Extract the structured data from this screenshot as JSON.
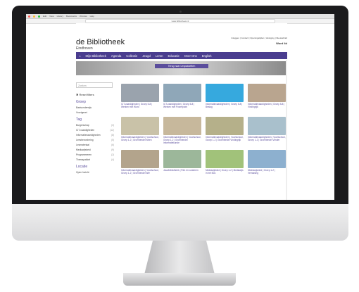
{
  "browser": {
    "menu": [
      "Edit",
      "View",
      "History",
      "Bookmarks",
      "Window",
      "Help"
    ],
    "url": "www.bibliotheek.nl"
  },
  "site": {
    "top_links": "Inloggen | Contact | Openingstijden | Vestiging | Nieuwsbrief",
    "logo": "de Bibliotheek",
    "logo_sub": "Eindhoven",
    "account_link": "Word lid",
    "nav": [
      "Mijn Bibliotheek",
      "Agenda",
      "Collectie",
      "Jeugd",
      "Leren",
      "Educatie",
      "Over Ons",
      "English"
    ],
    "hero_button": "Terug naar Lespakketten"
  },
  "sidebar": {
    "search_placeholder": "Zoeken",
    "reset": "Reset filters",
    "groups": [
      {
        "title": "Groep",
        "items": [
          {
            "label": "Basisonderwijs",
            "count": ""
          },
          {
            "label": "Voortgezet",
            "count": ""
          }
        ]
      },
      {
        "title": "Tag",
        "items": [
          {
            "label": "Burgerschap",
            "count": "(3)"
          },
          {
            "label": "ICT-vaardigheden",
            "count": "(12)"
          },
          {
            "label": "Informatievaardigheden",
            "count": "(8)"
          },
          {
            "label": "Leesbevordering",
            "count": "(5)"
          },
          {
            "label": "Lesmateriaal",
            "count": "(6)"
          },
          {
            "label": "Mediawijsheid",
            "count": "(9)"
          },
          {
            "label": "Programmeren",
            "count": "(2)"
          },
          {
            "label": "Themapakket",
            "count": "(4)"
          }
        ]
      },
      {
        "title": "Locatie",
        "items": [
          {
            "label": "Open Inzicht",
            "count": ""
          }
        ]
      }
    ]
  },
  "cards": [
    {
      "title": "ICT-vaardigheden | Groep 5-8 | Werken met Word",
      "color": "#9aa3ad"
    },
    {
      "title": "ICT-vaardigheden | Groep 5-8 | Werken met Powerpoint",
      "color": "#8fa7b8"
    },
    {
      "title": "Informatievaardigheden | Groep 5-8 | Beslag",
      "color": "#36a9de"
    },
    {
      "title": "Informatievaardigheden | Groep 5-8 | Vindingrijk",
      "color": "#b9a58f"
    },
    {
      "title": "Informatievaardigheden | Voortschool, Groep 1-2 | Groentendel Kitten",
      "color": "#c9c2a8"
    },
    {
      "title": "Informatievaardigheden | Voortschool, Groep 1-2 | Groentendel Informatiekunde",
      "color": "#c7b89c"
    },
    {
      "title": "Informatievaardigheden | Voortschool, Groep 1-2 | Groentendel Vindingrijk",
      "color": "#b5b08a"
    },
    {
      "title": "Informatievaardigheden | Voortschool, Groep 1-2 | Groentendel Vlinder",
      "color": "#a9c0cc"
    },
    {
      "title": "Informatievaardigheden | Voortschool, Groep 1-2 | Groentendel Wie",
      "color": "#b3a48c"
    },
    {
      "title": "Jouwbibliotheek | Film en Luisteren",
      "color": "#9cb79a"
    },
    {
      "title": "Mediawijsheid | Groep 1-2 | Mediawijs in het Bos",
      "color": "#a1c27a"
    },
    {
      "title": "Mediawijsheid | Groep 1-2 | Verrassing",
      "color": "#8db0cf"
    }
  ]
}
